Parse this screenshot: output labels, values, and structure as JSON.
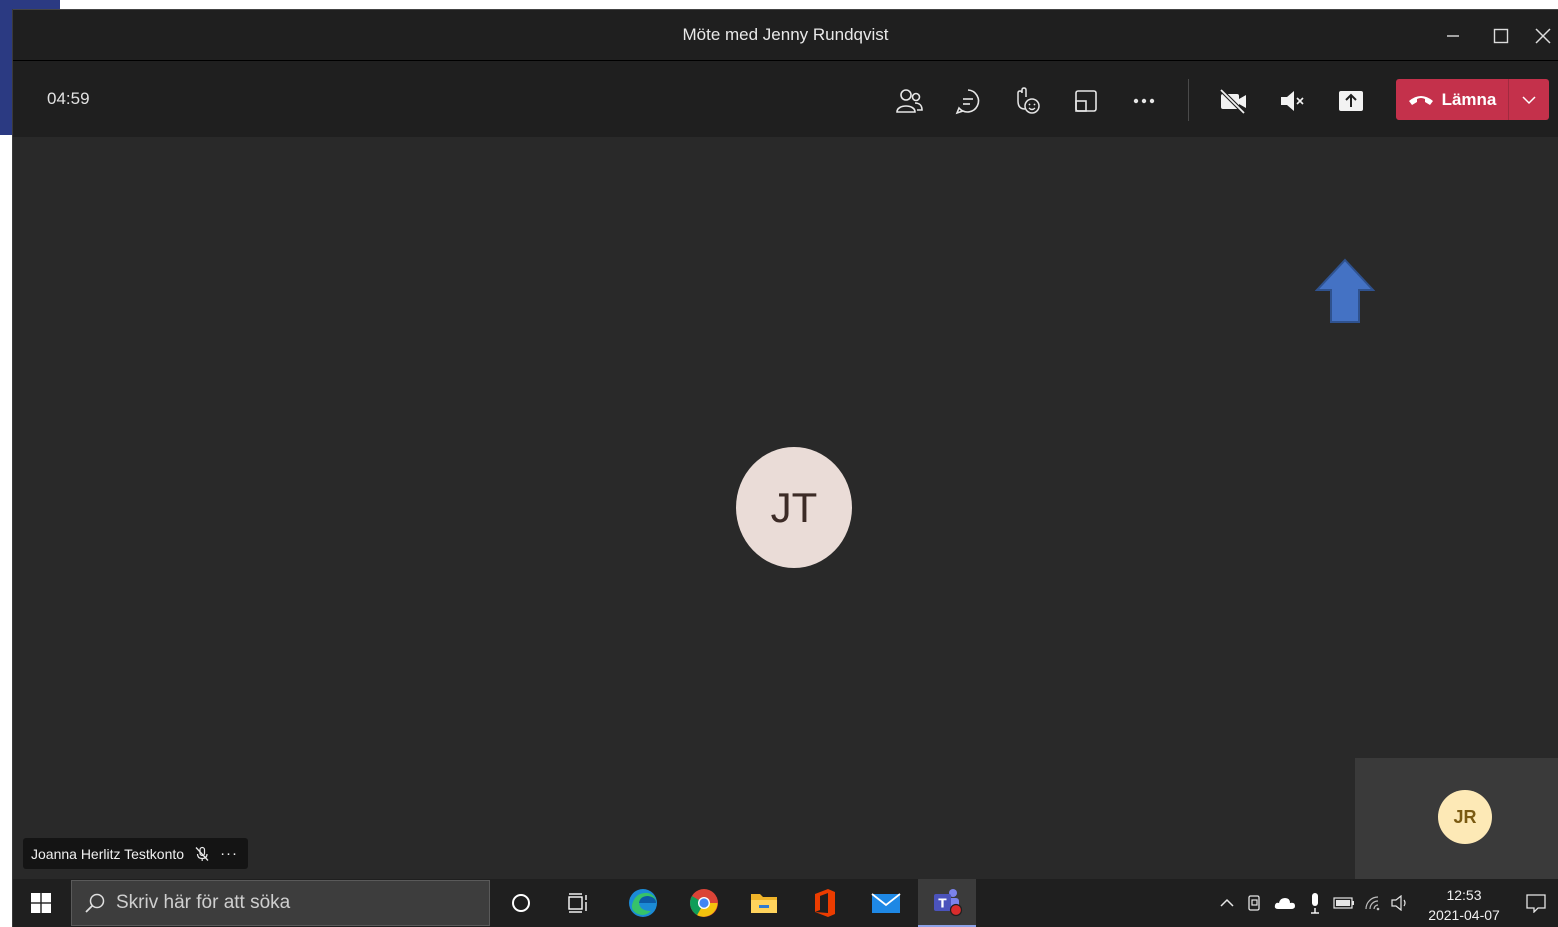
{
  "window": {
    "title": "Möte med Jenny Rundqvist"
  },
  "toolbar": {
    "timer": "04:59",
    "leave_label": "Lämna",
    "buttons": [
      "people-icon",
      "chat-icon",
      "reactions-icon",
      "rooms-icon",
      "more-icon",
      "camera-off-icon",
      "mic-muted-icon",
      "share-screen-icon"
    ]
  },
  "stage": {
    "main_avatar_initials": "JT",
    "self_avatar_initials": "JR",
    "participant_name": "Joanna Herlitz Testkonto",
    "more_symbol": "···"
  },
  "taskbar": {
    "search_placeholder": "Skriv här för att söka",
    "time": "12:53",
    "date": "2021-04-07"
  },
  "colors": {
    "leave_button": "#c4314b",
    "arrow_annotation": "#4472c4",
    "main_avatar_bg": "#eadcd7",
    "self_avatar_bg": "#fde9b6"
  }
}
